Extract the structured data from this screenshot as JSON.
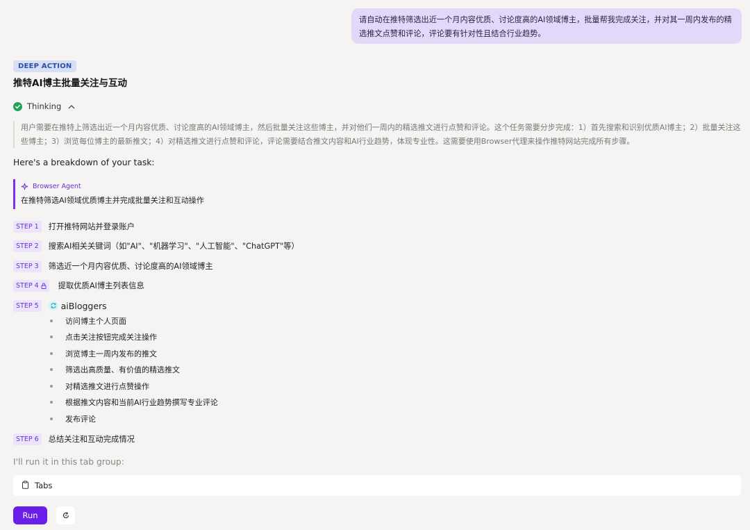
{
  "user_message": "请自动在推特筛选出近一个月内容优质、讨论度高的AI领域博主，批量帮我完成关注，并对其一周内发布的精选推文点赞和评论，评论要有针对性且结合行业趋势。",
  "badge": "DEEP ACTION",
  "task_title": "推特AI博主批量关注与互动",
  "thinking": {
    "label": "Thinking",
    "icon": "check-circle-icon",
    "text": "用户需要在推特上筛选出近一个月内容优质、讨论度高的AI领域博主，然后批量关注这些博主，并对他们一周内的精选推文进行点赞和评论。这个任务需要分步完成：1）首先搜索和识别优质AI博主；2）批量关注这些博主；3）浏览每位博主的最新推文；4）对精选推文进行点赞和评论，评论需要结合推文内容和AI行业趋势，体现专业性。这需要使用Browser代理来操作推特网站完成所有步骤。"
  },
  "breakdown_intro": "Here's a breakdown of your task:",
  "agent": {
    "name": "Browser Agent",
    "description": "在推特筛选AI领域优质博主并完成批量关注和互动操作"
  },
  "steps": [
    {
      "tag": "STEP 1",
      "text": "打开推特网站并登录账户"
    },
    {
      "tag": "STEP 2",
      "text": "搜索AI相关关键词（如\"AI\"、\"机器学习\"、\"人工智能\"、\"ChatGPT\"等）"
    },
    {
      "tag": "STEP 3",
      "text": "筛选近一个月内容优质、讨论度高的AI领域博主"
    },
    {
      "tag": "STEP 4",
      "text": "提取优质AI博主列表信息"
    },
    {
      "tag": "STEP 5",
      "text": "aiBloggers"
    },
    {
      "tag": "STEP 6",
      "text": "总结关注和互动完成情况"
    }
  ],
  "step5_subitems": [
    "访问博主个人页面",
    "点击关注按钮完成关注操作",
    "浏览博主一周内发布的推文",
    "筛选出高质量、有价值的精选推文",
    "对精选推文进行点赞操作",
    "根据推文内容和当前AI行业趋势撰写专业评论",
    "发布评论"
  ],
  "tab_group_label": "I'll run it in this tab group:",
  "tabs_label": "Tabs",
  "run_label": "Run",
  "colors": {
    "accent": "#6a1fe8",
    "badge_bg": "#d6dff5",
    "user_bubble": "#e4d8fa",
    "success": "#22a35a"
  }
}
